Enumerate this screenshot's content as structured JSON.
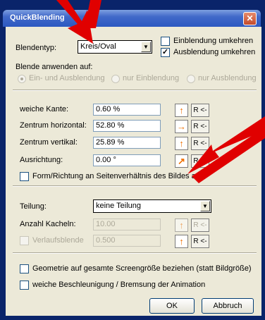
{
  "window": {
    "title": "QuickBlending",
    "close_icon": "✕"
  },
  "blend_type": {
    "label": "Blendentyp:",
    "value": "Kreis/Oval"
  },
  "checks_top": [
    {
      "label": "Einblendung umkehren",
      "checked": false
    },
    {
      "label": "Ausblendung umkehren",
      "checked": true
    }
  ],
  "apply_on": {
    "label": "Blende anwenden auf:",
    "options": [
      "Ein- und Ausblendung",
      "nur Einblendung",
      "nur Ausblendung"
    ]
  },
  "params": [
    {
      "label": "weiche Kante:",
      "value": "0.60 %"
    },
    {
      "label": "Zentrum horizontal:",
      "value": "52.80 %"
    },
    {
      "label": "Zentrum vertikal:",
      "value": "25.89 %"
    },
    {
      "label": "Ausrichtung:",
      "value": "0.00 °"
    }
  ],
  "reset_label": "R <-",
  "aspect_check": {
    "label": "Form/Richtung an Seitenverhältnis des Bildes angl"
  },
  "tiling": {
    "label": "Teilung:",
    "value": "keine Teilung",
    "count_label": "Anzahl Kacheln:",
    "count_value": "10.00",
    "gradient_label": "Verlaufsblende",
    "gradient_value": "0.500"
  },
  "bottom_checks": [
    {
      "label": "Geometrie auf gesamte Screengröße beziehen (statt Bildgröße)"
    },
    {
      "label": "weiche Beschleunigung / Bremsung der Animation"
    }
  ],
  "buttons": {
    "ok": "OK",
    "cancel": "Abbruch"
  },
  "colors": {
    "arrow": "#e00000",
    "titlebar": "#2c58c1",
    "face": "#ece9d8",
    "icon": "#f07000"
  }
}
